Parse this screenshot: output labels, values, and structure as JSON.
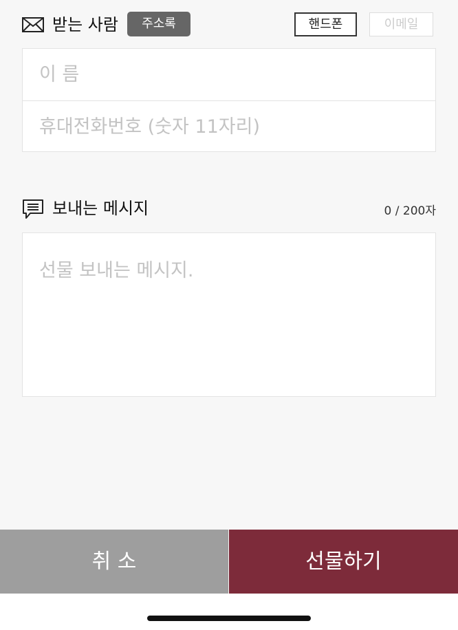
{
  "recipient": {
    "title": "받는 사람",
    "address_book_label": "주소록",
    "tabs": [
      {
        "label": "핸드폰",
        "selected": true
      },
      {
        "label": "이메일",
        "selected": false
      }
    ],
    "name_placeholder": "이 름",
    "phone_placeholder": "휴대전화번호 (숫자 11자리)",
    "icon": "mail-icon"
  },
  "message": {
    "title": "보내는 메시지",
    "char_count": "0 / 200자",
    "placeholder": "선물 보내는 메시지.",
    "icon": "speech-bubble-icon"
  },
  "actions": {
    "cancel_label": "취 소",
    "gift_label": "선물하기"
  },
  "colors": {
    "background": "#f7f7f7",
    "address_book_bg": "#666666",
    "cancel_bg": "#9e9e9e",
    "gift_bg": "#7d2b3a"
  }
}
